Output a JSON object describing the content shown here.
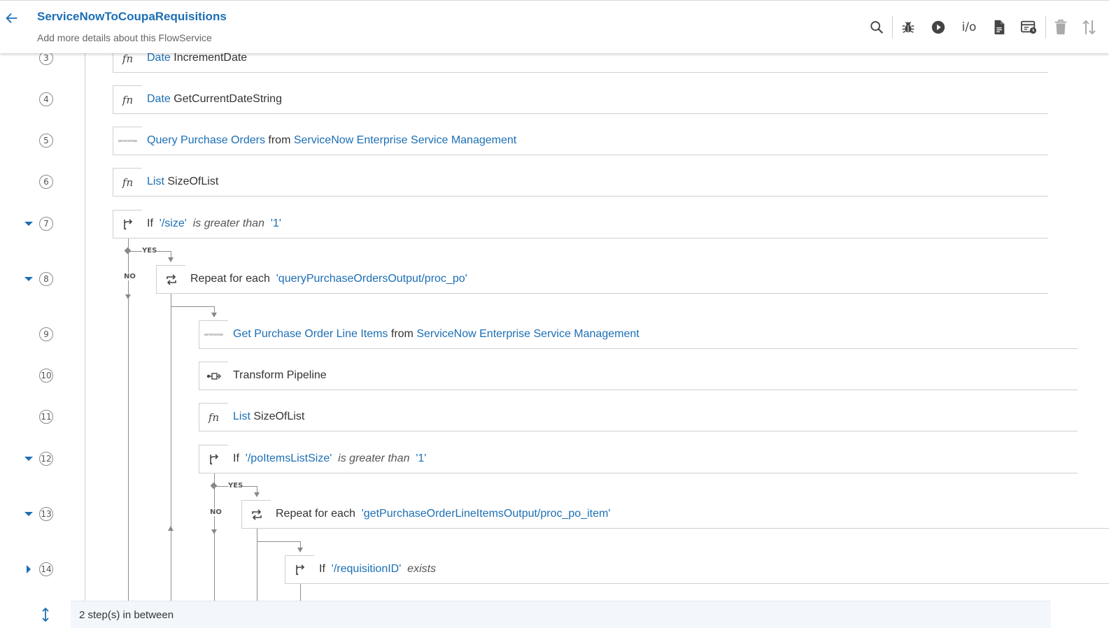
{
  "header": {
    "title": "ServiceNowToCoupaRequisitions",
    "subtitle": "Add more details about this FlowService",
    "toolbar": {
      "search_icon": "search-icon",
      "debug_icon": "bug-icon",
      "run_icon": "play-icon",
      "io_label": "i/o",
      "doc_icon": "document-icon",
      "schedule_icon": "schedule-icon",
      "delete_icon": "trash-icon",
      "sort_icon": "sort-icon"
    }
  },
  "colors": {
    "accent": "#1c6fb5",
    "rail": "#cfcfcf",
    "connector": "#888888"
  },
  "steps": [
    {
      "num": "3",
      "icon": "fn",
      "parts": [
        [
          "Date",
          "blue"
        ],
        [
          " IncrementDate",
          ""
        ]
      ]
    },
    {
      "num": "4",
      "icon": "fn",
      "parts": [
        [
          "Date",
          "blue"
        ],
        [
          " GetCurrentDateString",
          ""
        ]
      ]
    },
    {
      "num": "5",
      "icon": "servicenow",
      "parts": [
        [
          "Query Purchase Orders",
          "blue"
        ],
        [
          " from ",
          ""
        ],
        [
          "ServiceNow Enterprise Service Management",
          "blue"
        ]
      ]
    },
    {
      "num": "6",
      "icon": "fn",
      "parts": [
        [
          "List",
          "blue"
        ],
        [
          " SizeOfList",
          ""
        ]
      ]
    },
    {
      "num": "7",
      "icon": "branch",
      "parts": [
        [
          "If ",
          ""
        ],
        [
          " '/size' ",
          "blue"
        ],
        [
          " is greater than ",
          "it"
        ],
        [
          " '1'",
          "blue"
        ]
      ]
    },
    {
      "num": "8",
      "icon": "repeat",
      "parts": [
        [
          "Repeat for each ",
          ""
        ],
        [
          " 'queryPurchaseOrdersOutput/proc_po'",
          "blue"
        ]
      ]
    },
    {
      "num": "9",
      "icon": "servicenow",
      "parts": [
        [
          "Get Purchase Order Line Items",
          "blue"
        ],
        [
          " from ",
          ""
        ],
        [
          "ServiceNow Enterprise Service Management",
          "blue"
        ]
      ]
    },
    {
      "num": "10",
      "icon": "transform",
      "parts": [
        [
          "Transform Pipeline",
          ""
        ]
      ]
    },
    {
      "num": "11",
      "icon": "fn",
      "parts": [
        [
          "List",
          "blue"
        ],
        [
          " SizeOfList",
          ""
        ]
      ]
    },
    {
      "num": "12",
      "icon": "branch",
      "parts": [
        [
          "If ",
          ""
        ],
        [
          " '/poItemsListSize' ",
          "blue"
        ],
        [
          " is greater than ",
          "it"
        ],
        [
          " '1'",
          "blue"
        ]
      ]
    },
    {
      "num": "13",
      "icon": "repeat",
      "parts": [
        [
          "Repeat for each ",
          ""
        ],
        [
          " 'getPurchaseOrderLineItemsOutput/proc_po_item'",
          "blue"
        ]
      ]
    },
    {
      "num": "14",
      "icon": "branch",
      "parts": [
        [
          "If ",
          ""
        ],
        [
          " '/requisitionID' ",
          "blue"
        ],
        [
          " exists",
          "it"
        ]
      ]
    }
  ],
  "branch_labels": {
    "yes": "YES",
    "no": "NO"
  },
  "icon_text": {
    "fn": "fn",
    "servicenow": "servicenow"
  },
  "footer": {
    "text": "2 step(s) in between"
  }
}
